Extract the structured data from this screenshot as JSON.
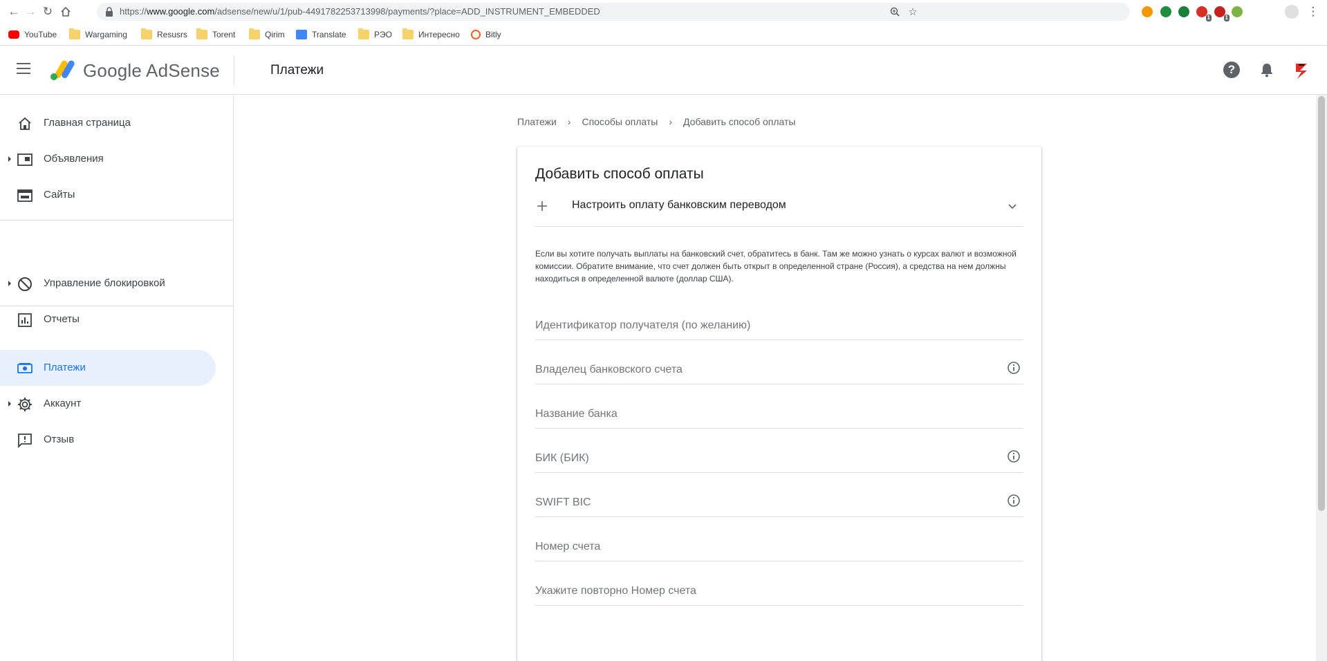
{
  "browser": {
    "url_prefix": "https://",
    "url_host": "www.google.com",
    "url_path": "/adsense/new/u/1/pub-4491782253713998/payments/?place=ADD_INSTRUMENT_EMBEDDED",
    "extensions": [
      {
        "name": "pumpkin-extension-icon",
        "color": "#f29900",
        "badge": ""
      },
      {
        "name": "green-extension-icon",
        "color": "#1e8e3e",
        "badge": ""
      },
      {
        "name": "shield-extension-icon",
        "color": "#188038",
        "badge": ""
      },
      {
        "name": "gmail-extension-icon",
        "color": "#d93025",
        "badge": "1"
      },
      {
        "name": "red-circle-extension-icon",
        "color": "#c5221f",
        "badge": "1"
      },
      {
        "name": "download-extension-icon",
        "color": "#7cb342",
        "badge": ""
      }
    ]
  },
  "bookmarks": [
    {
      "label": "YouTube",
      "icon": "youtube-icon",
      "color": "#ff0000"
    },
    {
      "label": "Wargaming",
      "icon": "folder-icon",
      "color": "#f6d36a"
    },
    {
      "label": "Resusrs",
      "icon": "folder-icon",
      "color": "#f6d36a"
    },
    {
      "label": "Torent",
      "icon": "folder-icon",
      "color": "#f6d36a"
    },
    {
      "label": "Qirim",
      "icon": "folder-icon",
      "color": "#f6d36a"
    },
    {
      "label": "Translate",
      "icon": "translate-icon",
      "color": "#4285f4"
    },
    {
      "label": "РЭО",
      "icon": "folder-icon",
      "color": "#f6d36a"
    },
    {
      "label": "Интересно",
      "icon": "folder-icon",
      "color": "#f6d36a"
    },
    {
      "label": "Bitly",
      "icon": "bitly-icon",
      "color": "#ee6123"
    }
  ],
  "header": {
    "brand": "Google AdSense",
    "title": "Платежи"
  },
  "sidebar": {
    "items": [
      {
        "label": "Главная страница",
        "icon": "home-icon",
        "has_caret": false,
        "active": false
      },
      {
        "label": "Объявления",
        "icon": "ads-icon",
        "has_caret": true,
        "active": false
      },
      {
        "label": "Сайты",
        "icon": "sites-icon",
        "has_caret": false,
        "active": false
      },
      {
        "label": "Управление блокировкой",
        "icon": "block-icon",
        "has_caret": true,
        "active": false
      },
      {
        "label": "Отчеты",
        "icon": "reports-icon",
        "has_caret": false,
        "active": false
      },
      {
        "label": "Платежи",
        "icon": "payments-icon",
        "has_caret": false,
        "active": true
      },
      {
        "label": "Аккаунт",
        "icon": "gear-icon",
        "has_caret": true,
        "active": false
      },
      {
        "label": "Отзыв",
        "icon": "feedback-icon",
        "has_caret": false,
        "active": false
      }
    ]
  },
  "breadcrumb": [
    "Платежи",
    "Способы оплаты",
    "Добавить способ оплаты"
  ],
  "card": {
    "title": "Добавить способ оплаты",
    "expander_label": "Настроить оплату банковским переводом",
    "info_text": "Если вы хотите получать выплаты на банковский счет, обратитесь в банк. Там же можно узнать о курсах валют и возможной комиссии. Обратите внимание, что счет должен быть открыт в определенной стране (Россия), а средства на нем должны находиться в определенной валюте (доллар США).",
    "fields": [
      {
        "label": "Идентификатор получателя (по желанию)",
        "has_info": false
      },
      {
        "label": "Владелец банковского счета",
        "has_info": true
      },
      {
        "label": "Название банка",
        "has_info": false
      },
      {
        "label": "БИК (БИК)",
        "has_info": true
      },
      {
        "label": "SWIFT BIC",
        "has_info": true
      },
      {
        "label": "Номер счета",
        "has_info": false
      },
      {
        "label": "Укажите повторно Номер счета",
        "has_info": false
      }
    ]
  },
  "colors": {
    "accent": "#1a73e8",
    "active_bg": "#e8f0fe",
    "divider": "#dadce0"
  }
}
